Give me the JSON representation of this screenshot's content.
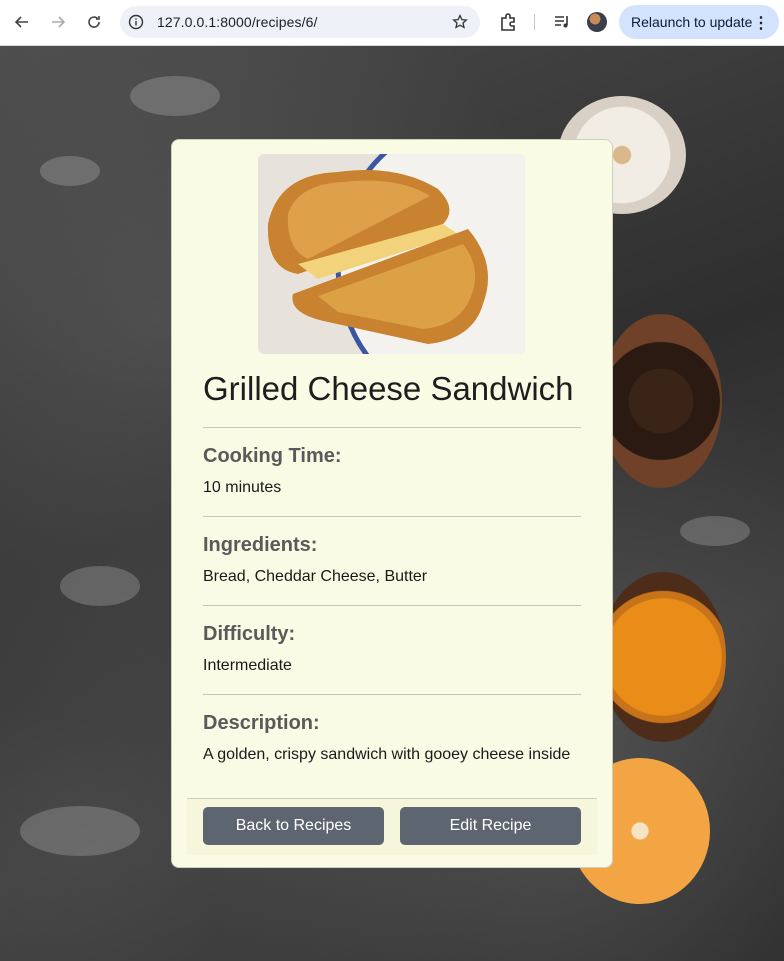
{
  "browser": {
    "url": "127.0.0.1:8000/recipes/6/",
    "relaunch_label": "Relaunch to update"
  },
  "recipe": {
    "title": "Grilled Cheese Sandwich",
    "fields": [
      {
        "label": "Cooking Time:",
        "value": "10 minutes"
      },
      {
        "label": "Ingredients:",
        "value": "Bread, Cheddar Cheese, Butter"
      },
      {
        "label": "Difficulty:",
        "value": "Intermediate"
      },
      {
        "label": "Description:",
        "value": "A golden, crispy sandwich with gooey cheese inside"
      }
    ]
  },
  "actions": {
    "back_label": "Back to Recipes",
    "edit_label": "Edit Recipe"
  },
  "colors": {
    "card_bg": "#fafbe4",
    "button_bg": "#5d6670",
    "relaunch_bg": "#d3e3fd"
  }
}
